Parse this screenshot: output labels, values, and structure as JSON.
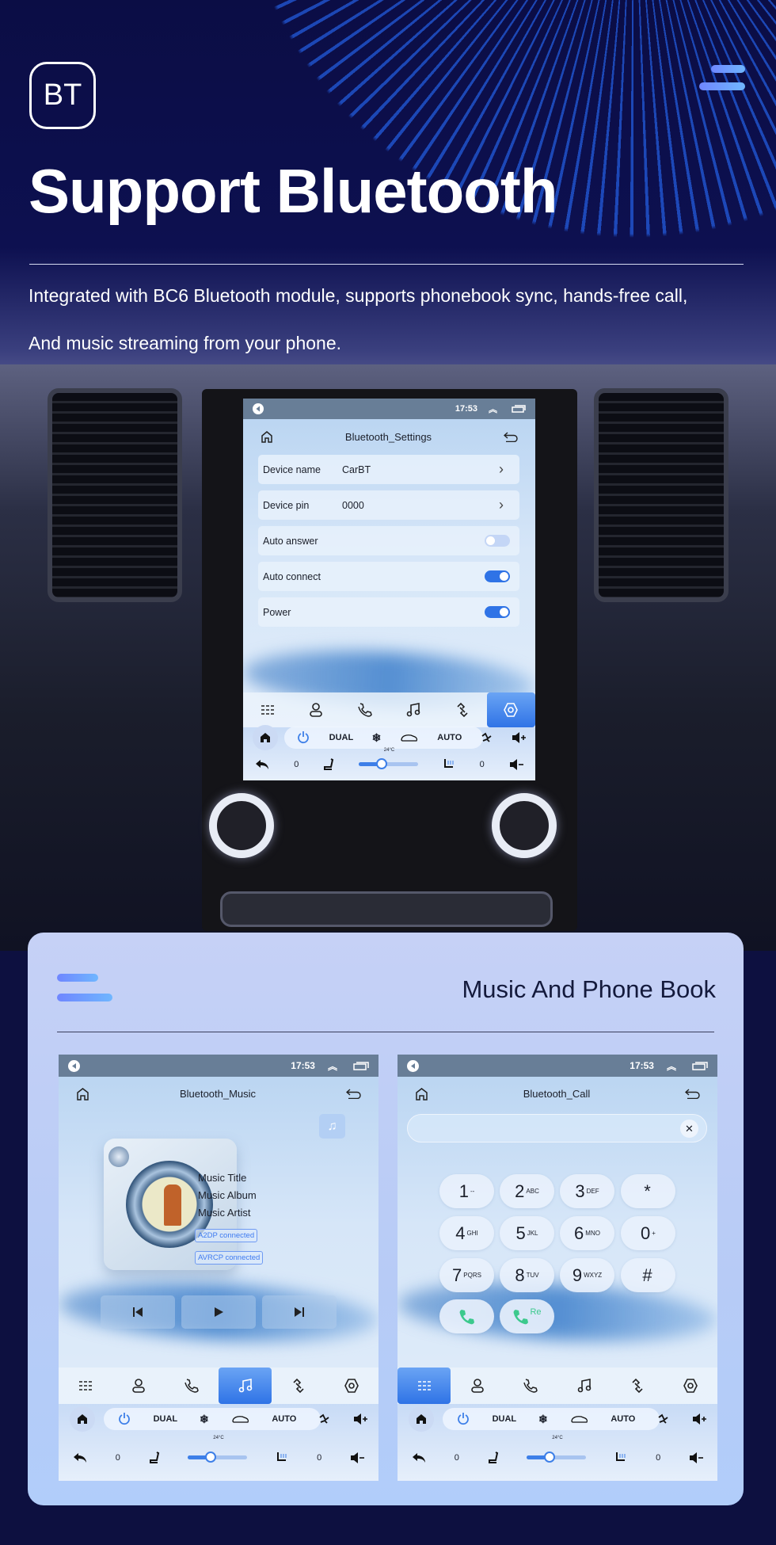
{
  "hero": {
    "badge": "BT",
    "title": "Support Bluetooth",
    "line1": "Integrated with BC6 Bluetooth module, supports phonebook sync, hands-free call,",
    "line2": "And music streaming from your phone."
  },
  "status": {
    "time": "17:53"
  },
  "climate": {
    "dual": "DUAL",
    "auto": "AUTO",
    "temp": "24°C",
    "left_level": "0",
    "right_level": "0",
    "fan_level_pct": 35
  },
  "nav_icons": [
    "keypad-icon",
    "contacts-icon",
    "call-log-icon",
    "music-icon",
    "link-icon",
    "settings-icon"
  ],
  "settings": {
    "title": "Bluetooth_Settings",
    "rows": [
      {
        "label": "Device name",
        "value": "CarBT"
      },
      {
        "label": "Device pin",
        "value": "0000"
      },
      {
        "label": "Auto answer",
        "on": false
      },
      {
        "label": "Auto connect",
        "on": true
      },
      {
        "label": "Power",
        "on": true
      }
    ]
  },
  "card": {
    "title": "Music And Phone Book"
  },
  "music": {
    "title": "Bluetooth_Music",
    "track_title": "Music Title",
    "album": "Music Album",
    "artist": "Music Artist",
    "badge1": "A2DP  connected",
    "badge2": "AVRCP connected"
  },
  "call": {
    "title": "Bluetooth_Call",
    "input_value": "",
    "keys": [
      {
        "d": "1",
        "s": "--"
      },
      {
        "d": "2",
        "s": "ABC"
      },
      {
        "d": "3",
        "s": "DEF"
      },
      {
        "d": "*",
        "s": ""
      },
      {
        "d": "4",
        "s": "GHI"
      },
      {
        "d": "5",
        "s": "JKL"
      },
      {
        "d": "6",
        "s": "MNO"
      },
      {
        "d": "0",
        "s": "+"
      },
      {
        "d": "7",
        "s": "PQRS"
      },
      {
        "d": "8",
        "s": "TUV"
      },
      {
        "d": "9",
        "s": "WXYZ"
      },
      {
        "d": "#",
        "s": ""
      }
    ],
    "redial": "Re"
  },
  "colors": {
    "accent": "#2f73e6",
    "toggle_on": "#2f73e6",
    "call_green": "#3cc98d",
    "status_bar": "#687e97"
  }
}
